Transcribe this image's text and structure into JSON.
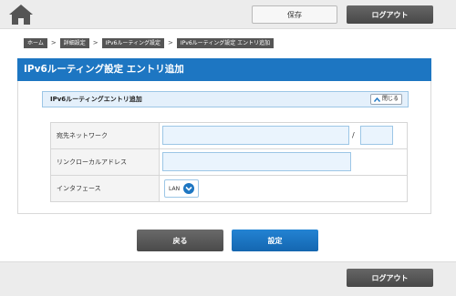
{
  "header": {
    "save_label": "保存",
    "logout_label": "ログアウト"
  },
  "breadcrumb": [
    "ホーム",
    "詳細設定",
    "IPv6ルーティング設定",
    "IPv6ルーティング設定 エントリ追加"
  ],
  "page": {
    "title": "IPv6ルーティング設定 エントリ追加"
  },
  "section": {
    "title": "IPv6ルーティングエントリ追加",
    "collapse_label": "閉じる"
  },
  "form": {
    "dest_network_label": "宛先ネットワーク",
    "dest_network_value": "",
    "prefix_length_value": "",
    "prefix_separator": "/",
    "link_local_label": "リンクローカルアドレス",
    "link_local_value": "",
    "interface_label": "インタフェース",
    "interface_selected": "LAN"
  },
  "actions": {
    "back_label": "戻る",
    "submit_label": "設定"
  },
  "footer": {
    "logout_label": "ログアウト"
  },
  "colors": {
    "accent": "#1d76c2",
    "dark_button": "#555555",
    "field_bg": "#eaf4fd"
  }
}
